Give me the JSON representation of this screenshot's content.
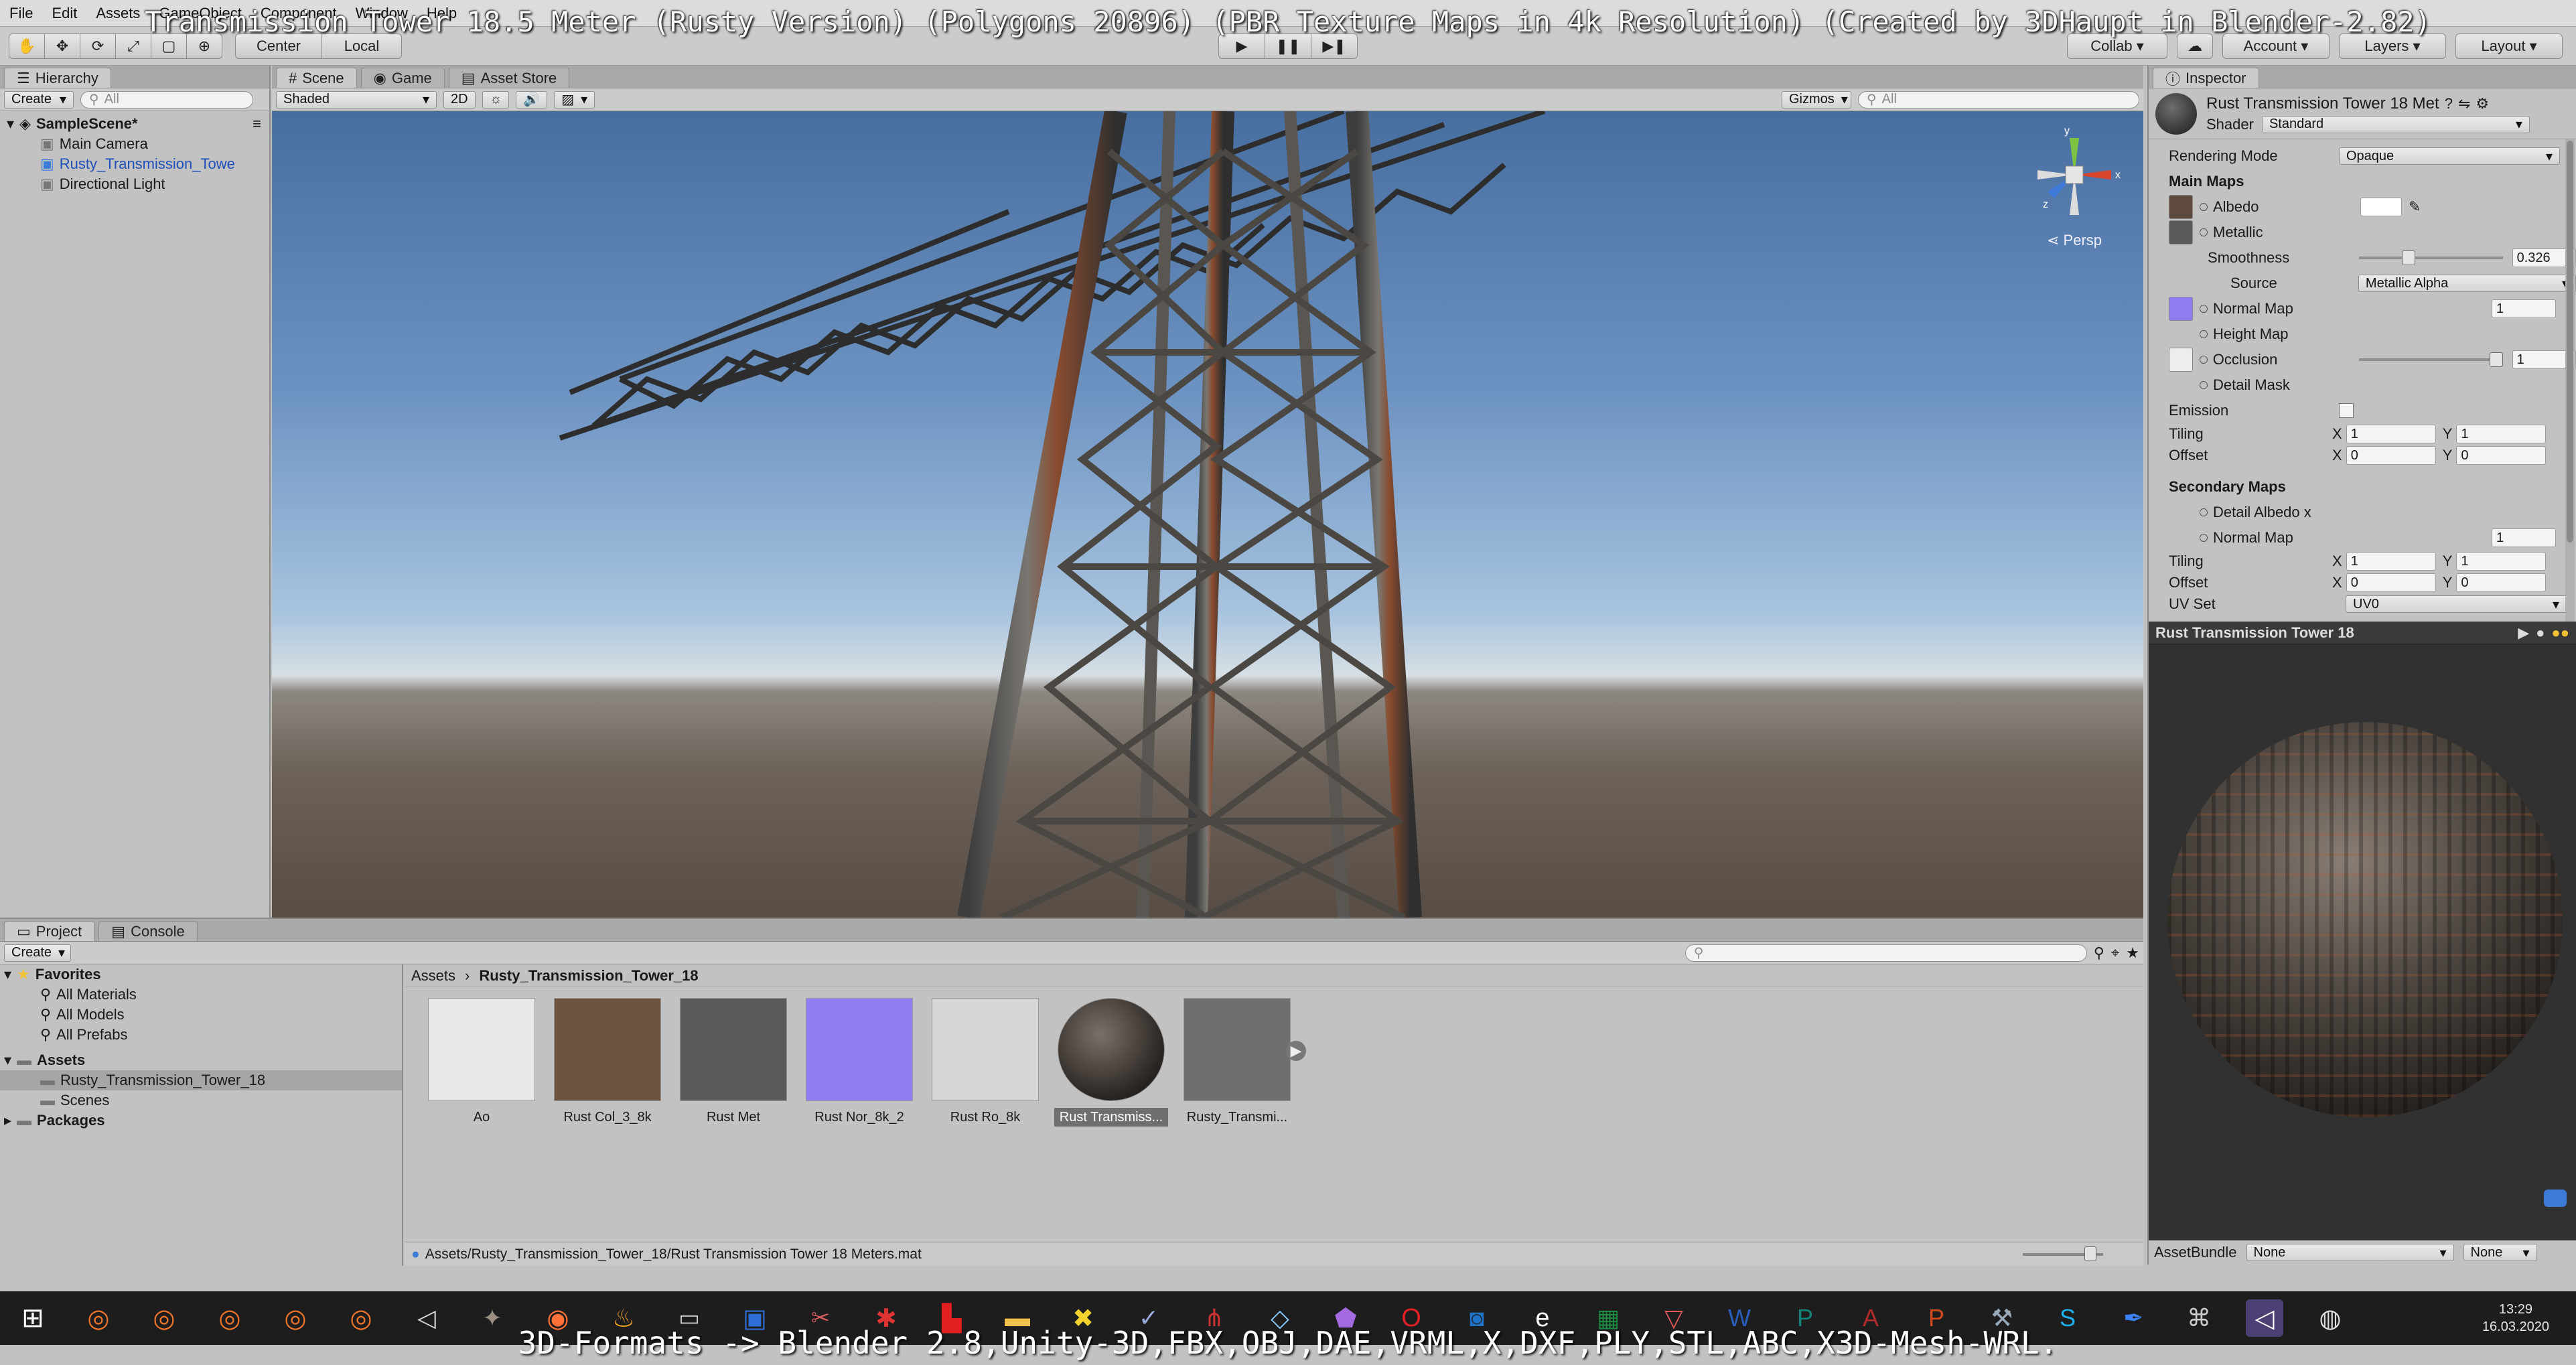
{
  "overlay": {
    "title": "Transmission Tower 18.5 Meter (Rusty Version) (Polygons 20896) (PBR Texture Maps in 4k Resolution) (Created by 3DHaupt in Blender-2.82)",
    "bottom_caption": "3D-Formats -> Blender 2.8,Unity-3D,FBX,OBJ,DAE,VRML,X,DXF,PLY,STL,ABC,X3D-Mesh-WRL."
  },
  "menu": [
    "File",
    "Edit",
    "Assets",
    "GameObject",
    "Component",
    "Window",
    "Help"
  ],
  "toolbar": {
    "pivot": "Center",
    "space": "Local",
    "collab": "Collab",
    "account": "Account",
    "layers": "Layers",
    "layout": "Layout"
  },
  "hierarchy": {
    "tab": "Hierarchy",
    "create": "Create",
    "search_placeholder": "All",
    "scene": "SampleScene*",
    "items": [
      "Main Camera",
      "Rusty_Transmission_Towe",
      "Directional Light"
    ]
  },
  "scene_view": {
    "tabs": [
      "Scene",
      "Game",
      "Asset Store"
    ],
    "shading": "Shaded",
    "mode_2d": "2D",
    "gizmos": "Gizmos",
    "search_placeholder": "All",
    "persp": "Persp",
    "gizmo_axes": [
      "y",
      "x",
      "z"
    ]
  },
  "inspector": {
    "tab": "Inspector",
    "material_name": "Rust Transmission Tower 18 Met",
    "shader_label": "Shader",
    "shader_value": "Standard",
    "rendering_mode_label": "Rendering Mode",
    "rendering_mode_value": "Opaque",
    "main_maps": "Main Maps",
    "albedo": "Albedo",
    "metallic": "Metallic",
    "smoothness_label": "Smoothness",
    "smoothness_value": "0.326",
    "smoothness_fraction": 0.326,
    "source_label": "Source",
    "source_value": "Metallic Alpha",
    "normal_map": "Normal Map",
    "normal_map_value": "1",
    "height_map": "Height Map",
    "occlusion": "Occlusion",
    "occlusion_value": "1",
    "detail_mask": "Detail Mask",
    "emission": "Emission",
    "tiling": "Tiling",
    "offset": "Offset",
    "x": "X",
    "y": "Y",
    "tiling_x": "1",
    "tiling_y": "1",
    "offset_x": "0",
    "offset_y": "0",
    "secondary_maps": "Secondary Maps",
    "detail_albedo": "Detail Albedo x",
    "normal_map_2": "Normal Map",
    "normal_map_2_value": "1",
    "tiling2_x": "1",
    "tiling2_y": "1",
    "offset2_x": "0",
    "offset2_y": "0",
    "uv_set_label": "UV Set",
    "uv_set_value": "UV0"
  },
  "preview": {
    "title": "Rust Transmission Tower 18",
    "assetbundle_label": "AssetBundle",
    "assetbundle_value": "None",
    "variant_value": "None"
  },
  "project": {
    "tabs": [
      "Project",
      "Console"
    ],
    "create": "Create",
    "favorites": "Favorites",
    "favorite_items": [
      "All Materials",
      "All Models",
      "All Prefabs"
    ],
    "assets": "Assets",
    "asset_folders": [
      "Rusty_Transmission_Tower_18",
      "Scenes"
    ],
    "packages": "Packages",
    "breadcrumb": [
      "Assets",
      "Rusty_Transmission_Tower_18"
    ],
    "asset_items": [
      {
        "label": "Ao",
        "color": "#e8e8e8"
      },
      {
        "label": "Rust Col_3_8k",
        "color": "#6b5340"
      },
      {
        "label": "Rust Met",
        "color": "#5a5a5a"
      },
      {
        "label": "Rust Nor_8k_2",
        "color": "#8f7df2"
      },
      {
        "label": "Rust Ro_8k",
        "color": "#d6d6d6"
      },
      {
        "label": "Rust Transmiss...",
        "color": "#3c3c3c"
      },
      {
        "label": "Rusty_Transmi...",
        "color": "#6f6f6f"
      }
    ],
    "status_path": "Assets/Rusty_Transmission_Tower_18/Rust Transmission Tower 18 Meters.mat"
  },
  "taskbar": {
    "time": "13:29",
    "date": "16.03.2020"
  },
  "colors": {
    "accent_blue": "#3d7bd6",
    "selection": "#a6a6a6",
    "sky_top": "#476ea0",
    "ground": "#574d45"
  }
}
